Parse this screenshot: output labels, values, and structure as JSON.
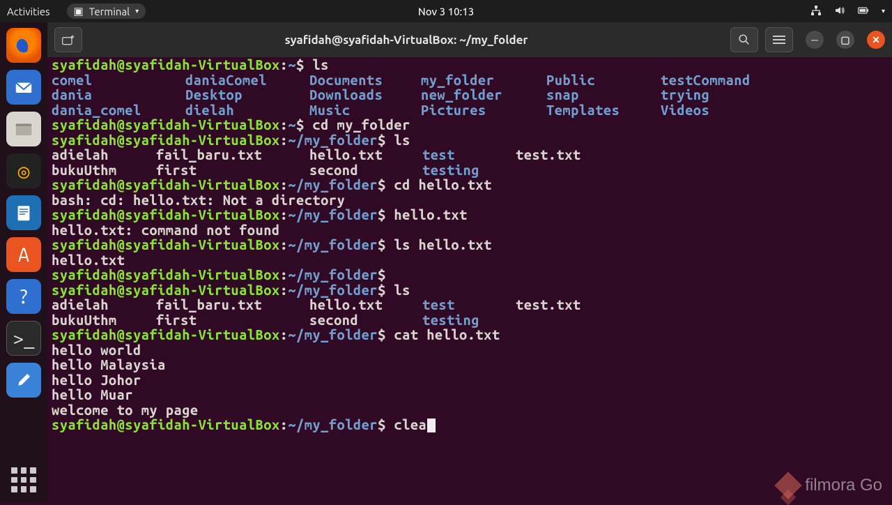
{
  "topbar": {
    "activities": "Activities",
    "app_label": "Terminal",
    "clock": "Nov 3  10:13"
  },
  "window": {
    "title": "syafidah@syafidah-VirtualBox: ~/my_folder"
  },
  "prompt": {
    "user_host": "syafidah@syafidah-VirtualBox",
    "home": "~",
    "folder": "~/my_folder",
    "sigil": "$"
  },
  "cmds": {
    "ls": "ls",
    "cd_my_folder": "cd my_folder",
    "cd_hello": "cd hello.txt",
    "hello_txt": "hello.txt",
    "ls_hello": "ls hello.txt",
    "cat_hello": "cat hello.txt",
    "clea": "clea"
  },
  "home_ls": {
    "r1": [
      "comel",
      "daniaComel",
      "Documents",
      "my_folder",
      "Public",
      "testCommand"
    ],
    "r2": [
      "dania",
      "Desktop",
      "Downloads",
      "new_folder",
      "snap",
      "trying"
    ],
    "r3": [
      "dania_comel",
      "dielah",
      "Music",
      "Pictures",
      "Templates",
      "Videos"
    ]
  },
  "folder_ls": {
    "r1": [
      "adielah",
      "fail_baru.txt",
      "hello.txt",
      "test",
      "test.txt"
    ],
    "r2": [
      "bukuUthm",
      "first",
      "second",
      "testing",
      ""
    ]
  },
  "errors": {
    "not_dir": "bash: cd: hello.txt: Not a directory",
    "not_found": "hello.txt: command not found"
  },
  "ls_hello_out": "hello.txt",
  "cat_out": [
    "hello world",
    "hello Malaysia",
    "hello Johor",
    "hello Muar",
    "welcome to my page"
  ],
  "watermark": "filmora Go"
}
